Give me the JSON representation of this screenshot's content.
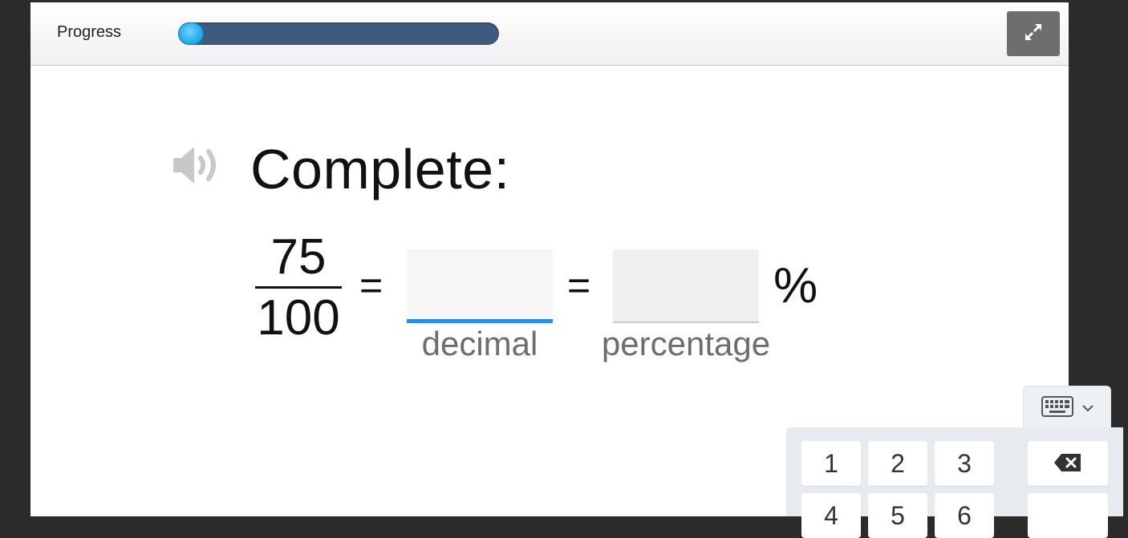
{
  "header": {
    "progress_label": "Progress",
    "progress_fraction": 0.04
  },
  "question": {
    "prompt": "Complete:",
    "numerator": "75",
    "denominator": "100",
    "equals_sign": "=",
    "decimal_input": {
      "value": "",
      "caption": "decimal"
    },
    "percentage_input": {
      "value": "",
      "caption": "percentage"
    },
    "percent_symbol": "%"
  },
  "keypad": {
    "row1": [
      "1",
      "2",
      "3"
    ],
    "row2": [
      "4",
      "5",
      "6"
    ],
    "backspace_icon": "backspace-icon",
    "toggle_icon": "keyboard-icon"
  },
  "colors": {
    "progress_track": "#3f5a7e",
    "progress_knob": "#1ba6e6",
    "active_input_underline": "#2d8ae0"
  }
}
